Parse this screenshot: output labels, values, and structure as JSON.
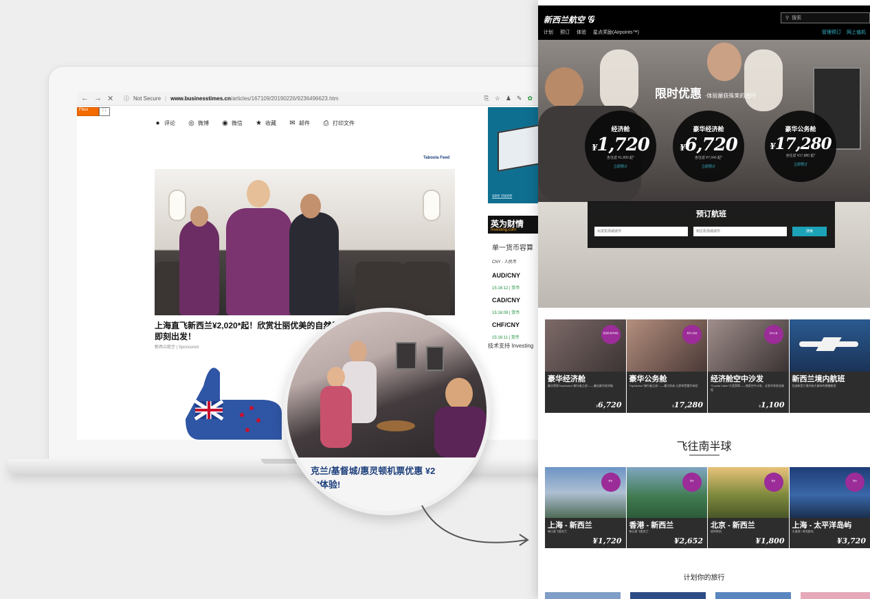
{
  "browser": {
    "security": "Not Secure",
    "url_host": "www.businesstimes.cn",
    "url_path": "/articles/167109/20190226/9236496623.htm"
  },
  "toolbar_tag": "Fbox",
  "share": [
    {
      "icon": "comment-icon",
      "label": "评论"
    },
    {
      "icon": "weibo-icon",
      "label": "微博"
    },
    {
      "icon": "wechat-icon",
      "label": "微信"
    },
    {
      "icon": "star-icon",
      "label": "收藏"
    },
    {
      "icon": "mail-icon",
      "label": "邮件"
    },
    {
      "icon": "print-icon",
      "label": "打印文件"
    }
  ],
  "taboola": "Taboola Feed",
  "article": {
    "title": "上海直飞新西兰¥2,020*起！欣赏壮丽优美的自然风光，",
    "title2": "即刻出发！",
    "source": "新西兰航空 | Sponsored"
  },
  "side": {
    "see_more": "see more",
    "investing_cn": "英为财情",
    "investing_en": "Investing.com",
    "fx_head": "单一货币容算",
    "fx_sub": "CNY - 人民币",
    "rows": [
      {
        "pair": "AUD/CNY",
        "time": "15:16:12 | 货币"
      },
      {
        "pair": "CAD/CNY",
        "time": "15:16:09 | 货币"
      },
      {
        "pair": "CHF/CNY",
        "time": "15:16:11 | 货币"
      }
    ],
    "footer": "技术支持 Investing"
  },
  "zoom": {
    "line1": "克兰/基督城/惠灵顿机票优惠 ¥2",
    "line2": "你体验!"
  },
  "nz": {
    "logo": "新西兰航空",
    "search_placeholder": "搜索",
    "nav": [
      "计划",
      "预订",
      "体验",
      "星点奖励(Airpoints™)"
    ],
    "nav_right": [
      "管理预订",
      "网上值机"
    ],
    "hero_title": "限时优惠",
    "hero_sub": "·体验屡获殊荣的出行",
    "prices": [
      {
        "class": "经济舱",
        "amount": "1,720",
        "sub": "含往返 ¥1,890 起*",
        "link": "立即预订"
      },
      {
        "class": "豪华经济舱",
        "amount": "6,720",
        "sub": "含往返 ¥7,040 起*",
        "link": "立即预订"
      },
      {
        "class": "豪华公务舱",
        "amount": "17,280",
        "sub": "含往返 ¥17,880 起*",
        "link": "立即预订"
      }
    ],
    "booking_title": "预订航班",
    "from_placeholder": "出发机场或城市",
    "to_placeholder": "到达机场或城市",
    "book_button": "搜索",
    "cards": [
      {
        "title": "豪华经济舱",
        "desc": "屡次荣获TripAdvisor\"旅行者之选\"——最佳豪华经济舱",
        "price": "6,720",
        "badge": "经济舱 豪华体验"
      },
      {
        "title": "豪华公务舱",
        "desc": "TripAdvisor\"旅行者之选\"——最大卧床 立即享受奢华体验",
        "price": "17,280",
        "badge": "豪华公务舱"
      },
      {
        "title": "经济舱空中沙发",
        "desc": "\"Crystal Cabin\"大奖获得——独家空中沙发，全家共享舒适旅程",
        "price": "1,100",
        "badge": "空中沙发"
      },
      {
        "title": "新西兰境内航班",
        "desc": "往返新西兰境内各大城市的便捷航班",
        "price": "",
        "badge": ""
      }
    ],
    "section_south": "飞往南半球",
    "dest": [
      {
        "title": "上海 - 新西兰",
        "desc": "每日直飞奥克兰",
        "price": "1,720",
        "badge": "特价"
      },
      {
        "title": "香港 - 新西兰",
        "desc": "每日直飞奥克兰",
        "price": "2,652",
        "badge": "特价"
      },
      {
        "title": "北京 - 新西兰",
        "desc": "经停转机",
        "price": "1,800",
        "badge": "特价"
      },
      {
        "title": "上海 - 太平洋岛屿",
        "desc": "大溪地 / 库克群岛",
        "price": "3,720",
        "badge": "特价"
      }
    ],
    "plan_title": "计划你的旅行"
  }
}
